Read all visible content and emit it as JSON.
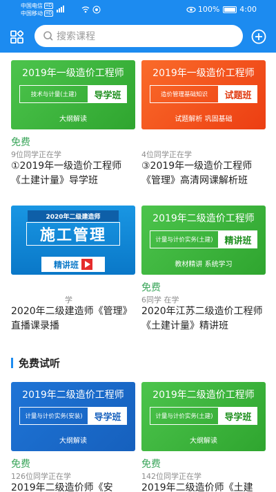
{
  "status_bar": {
    "carrier1": "中国电信",
    "carrier2": "中国移动",
    "network_tag": "HD",
    "battery": "100%",
    "time": "4:00"
  },
  "header": {
    "search_placeholder": "搜索课程"
  },
  "courses": [
    {
      "thumb_title": "2019年一级造价工程师",
      "thumb_subject": "技术与计量(土建)",
      "thumb_badge": "导学班",
      "thumb_bottom": "大纲解读",
      "price": "免费",
      "learners": "9位同学正在学",
      "title": "①2019年一级造价工程师《土建计量》导学班"
    },
    {
      "thumb_title": "2019年一级造价工程师",
      "thumb_subject": "造价管理基础知识",
      "thumb_badge": "试题班",
      "thumb_bottom": "试题解析  巩固基础",
      "price": "",
      "learners": "4位同学正在学",
      "title": "③2019年一级造价工程师《管理》高清网课解析班"
    },
    {
      "thumb_top": "2020年二级建造师",
      "thumb_main": "施工管理",
      "thumb_badge": "精讲班",
      "price": "",
      "learners": "学",
      "title": "2020年二级建造师《管理》直播课录播"
    },
    {
      "thumb_title": "2019年二级造价工程师",
      "thumb_subject": "计量与计价实务(土建)",
      "thumb_badge": "精讲班",
      "thumb_bottom": "教材精讲  系统学习",
      "price": "免费",
      "learners": "6同学  在学",
      "title": "2020年江苏二级造价工程师《土建计量》精讲班"
    }
  ],
  "section": {
    "title": "免费试听"
  },
  "free_courses": [
    {
      "thumb_title": "2019年二级造价工程师",
      "thumb_subject": "计量与计价实务(安装)",
      "thumb_badge": "导学班",
      "thumb_bottom": "大纲解读",
      "price": "免费",
      "learners": "126位同学正在学",
      "title": "2019年二级造价师《安"
    },
    {
      "thumb_title": "2019年二级造价工程师",
      "thumb_subject": "计量与计价实务(土建)",
      "thumb_badge": "导学班",
      "thumb_bottom": "大纲解读",
      "price": "免费",
      "learners": "142位同学正在学",
      "title": "2019年二级造价师《土建"
    }
  ],
  "colors": {
    "primary": "#1c8bf0",
    "price_green": "#3aa55a"
  }
}
